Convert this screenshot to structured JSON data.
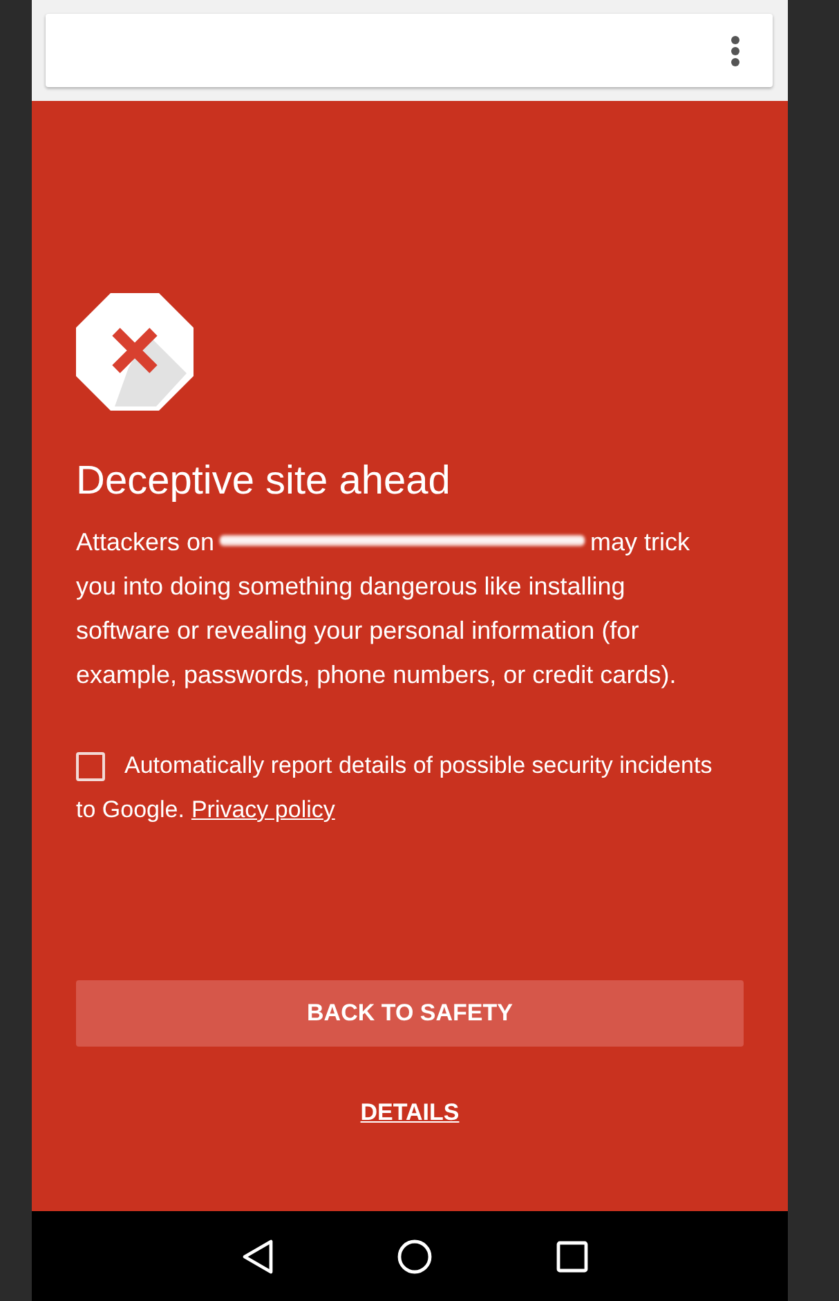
{
  "warning": {
    "title": "Deceptive site ahead",
    "message_start": "Attackers on",
    "message_end": "may trick you into doing something dangerous like installing software or revealing your personal information (for example, passwords, phone numbers, or credit cards)."
  },
  "report_option": {
    "checked": false,
    "label": "Automatically report details of possible security incidents",
    "label_continued": "to Google.",
    "link": "Privacy policy"
  },
  "buttons": [
    {
      "kind": "primary",
      "label": "BACK TO SAFETY"
    },
    {
      "kind": "link",
      "label": "DETAILS"
    }
  ]
}
